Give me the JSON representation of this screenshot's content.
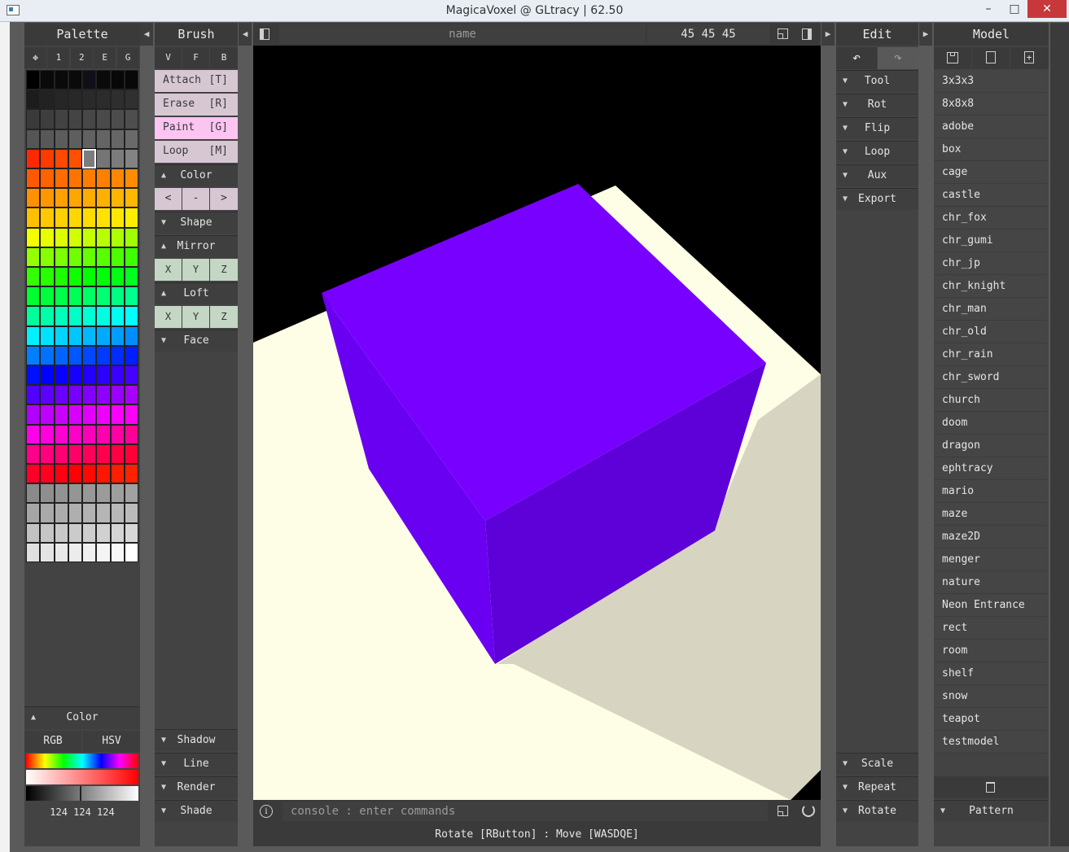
{
  "window": {
    "title": "MagicaVoxel @ GLtracy | 62.50",
    "controls": [
      "–",
      "□",
      "✕"
    ]
  },
  "palette": {
    "title": "Palette",
    "tabs": [
      "✥",
      "1",
      "2",
      "E",
      "G"
    ],
    "color_section": "Color",
    "modes": [
      "RGB",
      "HSV"
    ],
    "rgb_value": "124 124 124",
    "rows": [
      [
        "#000000",
        "#0a0a0a",
        "#0a0a0a",
        "#0a0a0a",
        "#10101a",
        "#0a0a0a",
        "#080808",
        "#080808"
      ],
      [
        "#1c1c1c",
        "#222222",
        "#262626",
        "#282828",
        "#2a2a2a",
        "#2c2c2c",
        "#2e2e2e",
        "#303030"
      ],
      [
        "#3a3a3a",
        "#3e3e3e",
        "#424242",
        "#444444",
        "#474747",
        "#4a4a4a",
        "#4c4c4c",
        "#4e4e4e"
      ],
      [
        "#555555",
        "#585858",
        "#5c5c5c",
        "#5e5e5e",
        "#616161",
        "#646464",
        "#666666",
        "#6a6a6a"
      ],
      [
        "#ff2800",
        "#ff3a00",
        "#ff4800",
        "#ff5000",
        "#7c7c7c",
        "#757575",
        "#7c7c7c",
        "#838383"
      ],
      [
        "#ff5a00",
        "#ff6200",
        "#ff6c00",
        "#ff7400",
        "#ff7c00",
        "#ff8000",
        "#ff8600",
        "#ff8c00"
      ],
      [
        "#ff9000",
        "#ff9800",
        "#ffa000",
        "#ffa600",
        "#ffac00",
        "#ffb000",
        "#ffb400",
        "#ffb800"
      ],
      [
        "#ffc000",
        "#ffc800",
        "#ffd000",
        "#ffd600",
        "#ffdc00",
        "#ffe200",
        "#ffe800",
        "#ffee00"
      ],
      [
        "#f4ff00",
        "#e8ff00",
        "#dcff00",
        "#d0ff00",
        "#c4ff00",
        "#b8ff00",
        "#acff00",
        "#a0ff00"
      ],
      [
        "#94ff00",
        "#88ff00",
        "#7cff00",
        "#70ff00",
        "#64ff00",
        "#58ff00",
        "#4cff00",
        "#40ff00"
      ],
      [
        "#34ff00",
        "#28ff00",
        "#1cff00",
        "#10ff00",
        "#04ff00",
        "#00ff08",
        "#00ff14",
        "#00ff20"
      ],
      [
        "#00ff2c",
        "#00ff3a",
        "#00ff48",
        "#00ff56",
        "#00ff64",
        "#00ff72",
        "#00ff80",
        "#00ff8e"
      ],
      [
        "#00ff9c",
        "#00ffaa",
        "#00ffb8",
        "#00ffc6",
        "#00ffd4",
        "#00ffe2",
        "#00fff0",
        "#00fffe"
      ],
      [
        "#00f0ff",
        "#00e2ff",
        "#00d4ff",
        "#00c6ff",
        "#00b8ff",
        "#00aaff",
        "#009cff",
        "#008eff"
      ],
      [
        "#0080ff",
        "#0072ff",
        "#0064ff",
        "#0056ff",
        "#0048ff",
        "#003aff",
        "#002cff",
        "#001eff"
      ],
      [
        "#0010ff",
        "#0002ff",
        "#0a00ff",
        "#1600ff",
        "#2200ff",
        "#2e00ff",
        "#3a00ff",
        "#4600ff"
      ],
      [
        "#5200ff",
        "#5e00ff",
        "#6a00ff",
        "#7600ff",
        "#8200ff",
        "#8e00ff",
        "#9a00ff",
        "#a600ff"
      ],
      [
        "#b200ff",
        "#be00ff",
        "#ca00ff",
        "#d600ff",
        "#e200ff",
        "#ee00ff",
        "#fa00ff",
        "#ff00f6"
      ],
      [
        "#ff00ea",
        "#ff00de",
        "#ff00d2",
        "#ff00c6",
        "#ff00ba",
        "#ff00ae",
        "#ff00a2",
        "#ff0096"
      ],
      [
        "#ff008a",
        "#ff007e",
        "#ff0072",
        "#ff0066",
        "#ff005a",
        "#ff004e",
        "#ff0042",
        "#ff0036"
      ],
      [
        "#ff002a",
        "#ff001e",
        "#ff0012",
        "#ff0006",
        "#ff0a00",
        "#ff1600",
        "#ff1e00",
        "#ff2200"
      ],
      [
        "#8a8a8a",
        "#8e8e8e",
        "#929292",
        "#959595",
        "#989898",
        "#9b9b9b",
        "#9e9e9e",
        "#a1a1a1"
      ],
      [
        "#a6a6a6",
        "#a9a9a9",
        "#acacac",
        "#afafaf",
        "#b2b2b2",
        "#b5b5b5",
        "#b8b8b8",
        "#bbbbbb"
      ],
      [
        "#c2c2c2",
        "#c5c5c5",
        "#c8c8c8",
        "#cbcbcb",
        "#cecece",
        "#d1d1d1",
        "#d4d4d4",
        "#d7d7d7"
      ],
      [
        "#e0e0e0",
        "#e4e4e4",
        "#e8e8e8",
        "#ececec",
        "#f0f0f0",
        "#f4f4f4",
        "#f8f8f8",
        "#ffffff"
      ]
    ]
  },
  "brush": {
    "title": "Brush",
    "tabs": [
      "V",
      "F",
      "B"
    ],
    "tools": [
      {
        "label": "Attach",
        "key": "[T]"
      },
      {
        "label": "Erase",
        "key": "[R]"
      },
      {
        "label": "Paint",
        "key": "[G]"
      },
      {
        "label": "Loop",
        "key": "[M]"
      }
    ],
    "color_label": "Color",
    "color_nav": [
      "<",
      "-",
      ">"
    ],
    "shape_label": "Shape",
    "mirror_label": "Mirror",
    "mirror_axes": [
      "X",
      "Y",
      "Z"
    ],
    "loft_label": "Loft",
    "loft_axes": [
      "X",
      "Y",
      "Z"
    ],
    "face_label": "Face",
    "bottom": [
      "Shadow",
      "Line",
      "Render",
      "Shade"
    ]
  },
  "viewport": {
    "name_placeholder": "name",
    "size": "45  45  45",
    "console_prompt": "console : enter commands",
    "status": "Rotate [RButton] : Move [WASDQE]",
    "cube_color": "#7800ff"
  },
  "edit": {
    "title": "Edit",
    "items": [
      "Tool",
      "Rot",
      "Flip",
      "Loop",
      "Aux",
      "Export"
    ],
    "bottom": [
      "Scale",
      "Repeat",
      "Rotate"
    ]
  },
  "model": {
    "title": "Model",
    "items": [
      "3x3x3",
      "8x8x8",
      "adobe",
      "box",
      "cage",
      "castle",
      "chr_fox",
      "chr_gumi",
      "chr_jp",
      "chr_knight",
      "chr_man",
      "chr_old",
      "chr_rain",
      "chr_sword",
      "church",
      "doom",
      "dragon",
      "ephtracy",
      "mario",
      "maze",
      "maze2D",
      "menger",
      "nature",
      "Neon Entrance",
      "rect",
      "room",
      "shelf",
      "snow",
      "teapot",
      "testmodel"
    ],
    "pattern_label": "Pattern"
  }
}
